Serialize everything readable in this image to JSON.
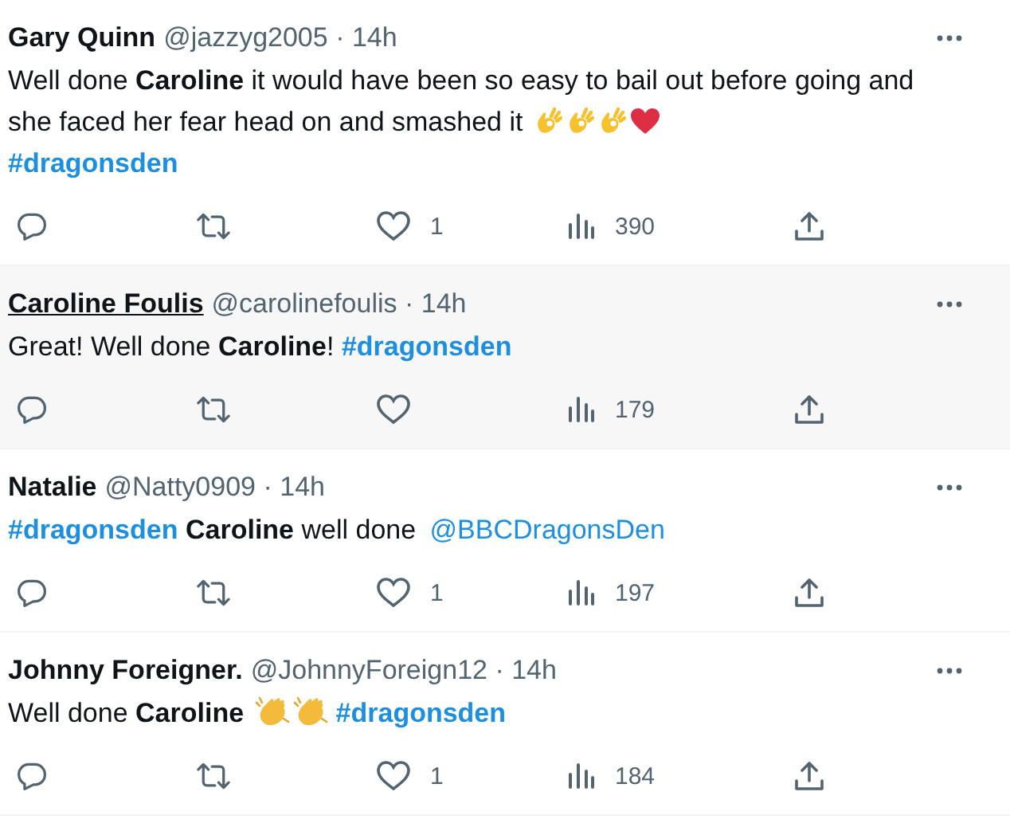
{
  "tweets": [
    {
      "name": "Gary Quinn",
      "handle": "@jazzyg2005",
      "separator": "·",
      "time": "14h",
      "hovered": false,
      "body": [
        {
          "kind": "text",
          "text": "Well done **Caroline** it would have been so easy to bail out before going and she faced her fear head on and smashed it "
        },
        {
          "kind": "ok-emoji"
        },
        {
          "kind": "ok-emoji"
        },
        {
          "kind": "ok-emoji"
        },
        {
          "kind": "heart-emoji"
        },
        {
          "kind": "break"
        },
        {
          "kind": "hashtag",
          "text": "#dragonsden"
        }
      ],
      "likes": "1",
      "views": "390"
    },
    {
      "name": "Caroline Foulis",
      "handle": "@carolinefoulis",
      "separator": "·",
      "time": "14h",
      "hovered": true,
      "body": [
        {
          "kind": "text",
          "text": "Great! Well done **Caroline**! "
        },
        {
          "kind": "hashtag",
          "text": "#dragonsden"
        }
      ],
      "views": "179"
    },
    {
      "name": "Natalie",
      "handle": "@Natty0909",
      "separator": "·",
      "time": "14h",
      "hovered": false,
      "body": [
        {
          "kind": "hashtag",
          "text": "#dragonsden"
        },
        {
          "kind": "text",
          "text": " **Caroline** well done "
        },
        {
          "kind": "mention",
          "text": "@BBCDragonsDen"
        }
      ],
      "likes": "1",
      "views": "197"
    },
    {
      "name": "Johnny Foreigner.",
      "handle": "@JohnnyForeign12",
      "separator": "·",
      "time": "14h",
      "hovered": false,
      "body": [
        {
          "kind": "text",
          "text": "Well done **Caroline** "
        },
        {
          "kind": "clap-emoji"
        },
        {
          "kind": "clap-emoji"
        },
        {
          "kind": "hashtag",
          "text": "#dragonsden"
        }
      ],
      "likes": "1",
      "views": "184"
    }
  ]
}
